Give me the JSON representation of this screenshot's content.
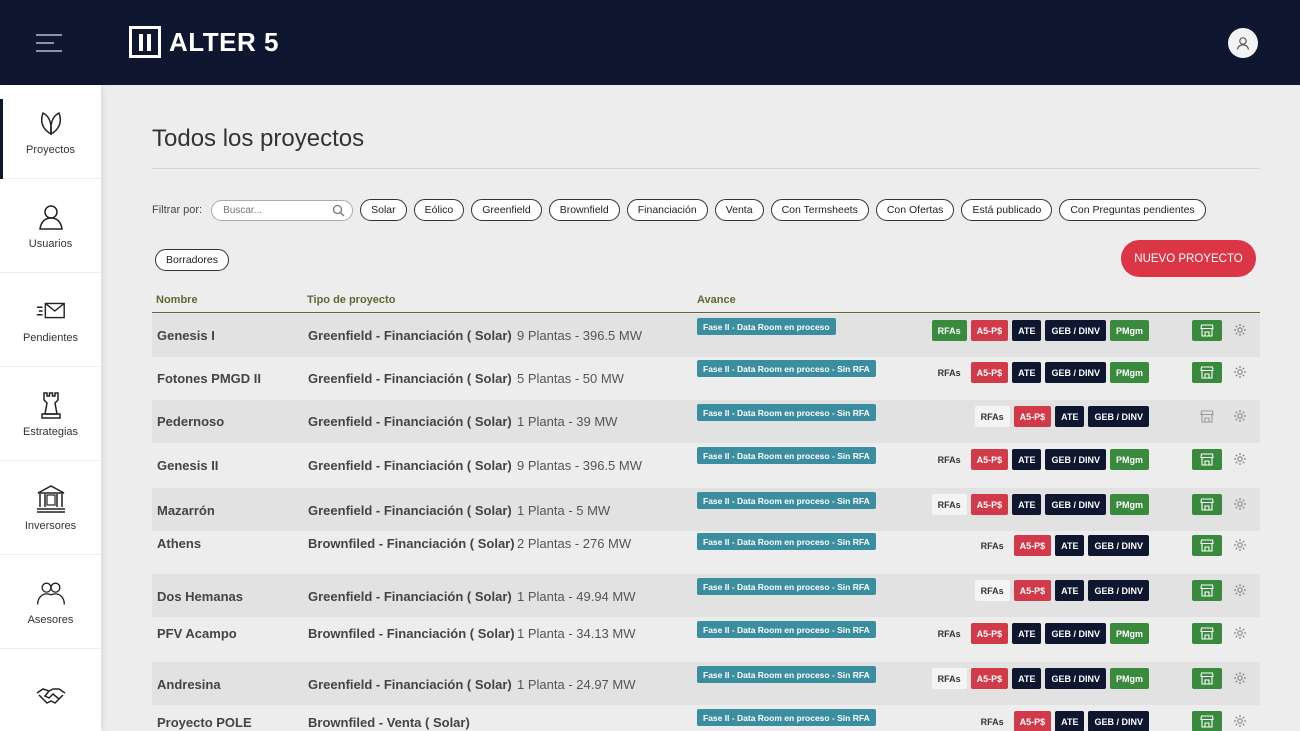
{
  "header": {
    "brand": "ALTER 5"
  },
  "sidebar": {
    "items": [
      {
        "label": "Proyectos"
      },
      {
        "label": "Usuarios"
      },
      {
        "label": "Pendientes"
      },
      {
        "label": "Estrategias"
      },
      {
        "label": "Inversores"
      },
      {
        "label": "Asesores"
      },
      {
        "label": ""
      }
    ]
  },
  "page": {
    "title": "Todos los proyectos"
  },
  "filters": {
    "label": "Filtrar por:",
    "search_placeholder": "Buscar...",
    "chips": [
      "Solar",
      "Eólico",
      "Greenfield",
      "Brownfield",
      "Financiación",
      "Venta",
      "Con Termsheets",
      "Con Ofertas",
      "Está publicado",
      "Con Preguntas pendientes"
    ],
    "drafts": "Borradores"
  },
  "actions": {
    "new_project": "NUEVO PROYECTO"
  },
  "table": {
    "headers": {
      "name": "Nombre",
      "type": "Tipo de proyecto",
      "progress": "Avance"
    },
    "rows": [
      {
        "name": "Genesis I",
        "type": "Greenfield - Financiación ( Solar)",
        "plants": "9 Plantas - 396.5 MW",
        "stage": "Fase II - Data Room en proceso",
        "rfa": "RFAs",
        "rfa_style": "green",
        "a5": "A5-P$",
        "ate": "ATE",
        "geb": "GEB / DINV",
        "pm": "PMgm",
        "store_green": true
      },
      {
        "name": "Fotones PMGD II",
        "type": "Greenfield - Financiación ( Solar)",
        "plants": "5 Plantas - 50 MW",
        "stage": "Fase II - Data Room en proceso - Sin RFA",
        "rfa": "RFAs",
        "rfa_style": "plain",
        "a5": "A5-P$",
        "ate": "ATE",
        "geb": "GEB / DINV",
        "pm": "PMgm",
        "store_green": true
      },
      {
        "name": "Pedernoso",
        "type": "Greenfield - Financiación ( Solar)",
        "plants": "1 Planta - 39 MW",
        "stage": "Fase II - Data Room en proceso - Sin RFA",
        "rfa": "RFAs",
        "rfa_style": "white",
        "a5": "A5-P$",
        "ate": "ATE",
        "geb": "GEB / DINV",
        "pm": "",
        "store_green": false
      },
      {
        "name": "Genesis II",
        "type": "Greenfield - Financiación ( Solar)",
        "plants": "9 Plantas - 396.5 MW",
        "stage": "Fase II - Data Room en proceso - Sin RFA",
        "rfa": "RFAs",
        "rfa_style": "plain",
        "a5": "A5-P$",
        "ate": "ATE",
        "geb": "GEB / DINV",
        "pm": "PMgm",
        "store_green": true
      },
      {
        "name": "Mazarrón",
        "type": "Greenfield - Financiación ( Solar)",
        "plants": "1 Planta - 5 MW",
        "stage": "Fase II - Data Room en proceso - Sin RFA",
        "rfa": "RFAs",
        "rfa_style": "white",
        "a5": "A5-P$",
        "ate": "ATE",
        "geb": "GEB / DINV",
        "pm": "PMgm",
        "store_green": true
      },
      {
        "name": "Athens",
        "type": "Brownfiled - Financiación ( Solar)",
        "plants": "2 Plantas - 276 MW",
        "stage": "Fase II - Data Room en proceso - Sin RFA",
        "rfa": "RFAs",
        "rfa_style": "plain",
        "a5": "A5-P$",
        "ate": "ATE",
        "geb": "GEB / DINV",
        "pm": "",
        "store_green": true
      },
      {
        "name": "Dos Hemanas",
        "type": "Greenfield - Financiación ( Solar)",
        "plants": "1 Planta - 49.94 MW",
        "stage": "Fase II - Data Room en proceso - Sin RFA",
        "rfa": "RFAs",
        "rfa_style": "white",
        "a5": "A5-P$",
        "ate": "ATE",
        "geb": "GEB / DINV",
        "pm": "",
        "store_green": true
      },
      {
        "name": "PFV Acampo",
        "type": "Brownfiled - Financiación ( Solar)",
        "plants": "1 Planta - 34.13 MW",
        "stage": "Fase II - Data Room en proceso - Sin RFA",
        "rfa": "RFAs",
        "rfa_style": "plain",
        "a5": "A5-P$",
        "ate": "ATE",
        "geb": "GEB / DINV",
        "pm": "PMgm",
        "store_green": true
      },
      {
        "name": "Andresina",
        "type": "Greenfield - Financiación ( Solar)",
        "plants": "1 Planta - 24.97 MW",
        "stage": "Fase II - Data Room en proceso - Sin RFA",
        "rfa": "RFAs",
        "rfa_style": "white",
        "a5": "A5-P$",
        "ate": "ATE",
        "geb": "GEB / DINV",
        "pm": "PMgm",
        "store_green": true
      },
      {
        "name": "Proyecto POLE",
        "type": "Brownfiled - Venta ( Solar)",
        "plants": "",
        "stage": "Fase II - Data Room en proceso - Sin RFA",
        "rfa": "RFAs",
        "rfa_style": "plain",
        "a5": "A5-P$",
        "ate": "ATE",
        "geb": "GEB / DINV",
        "pm": "",
        "store_green": true
      }
    ]
  },
  "colors": {
    "navy": "#0e1630",
    "red": "#dc3545",
    "green": "#3a8a3e",
    "teal": "#3b8e9f",
    "olive": "#5b6b2f"
  }
}
